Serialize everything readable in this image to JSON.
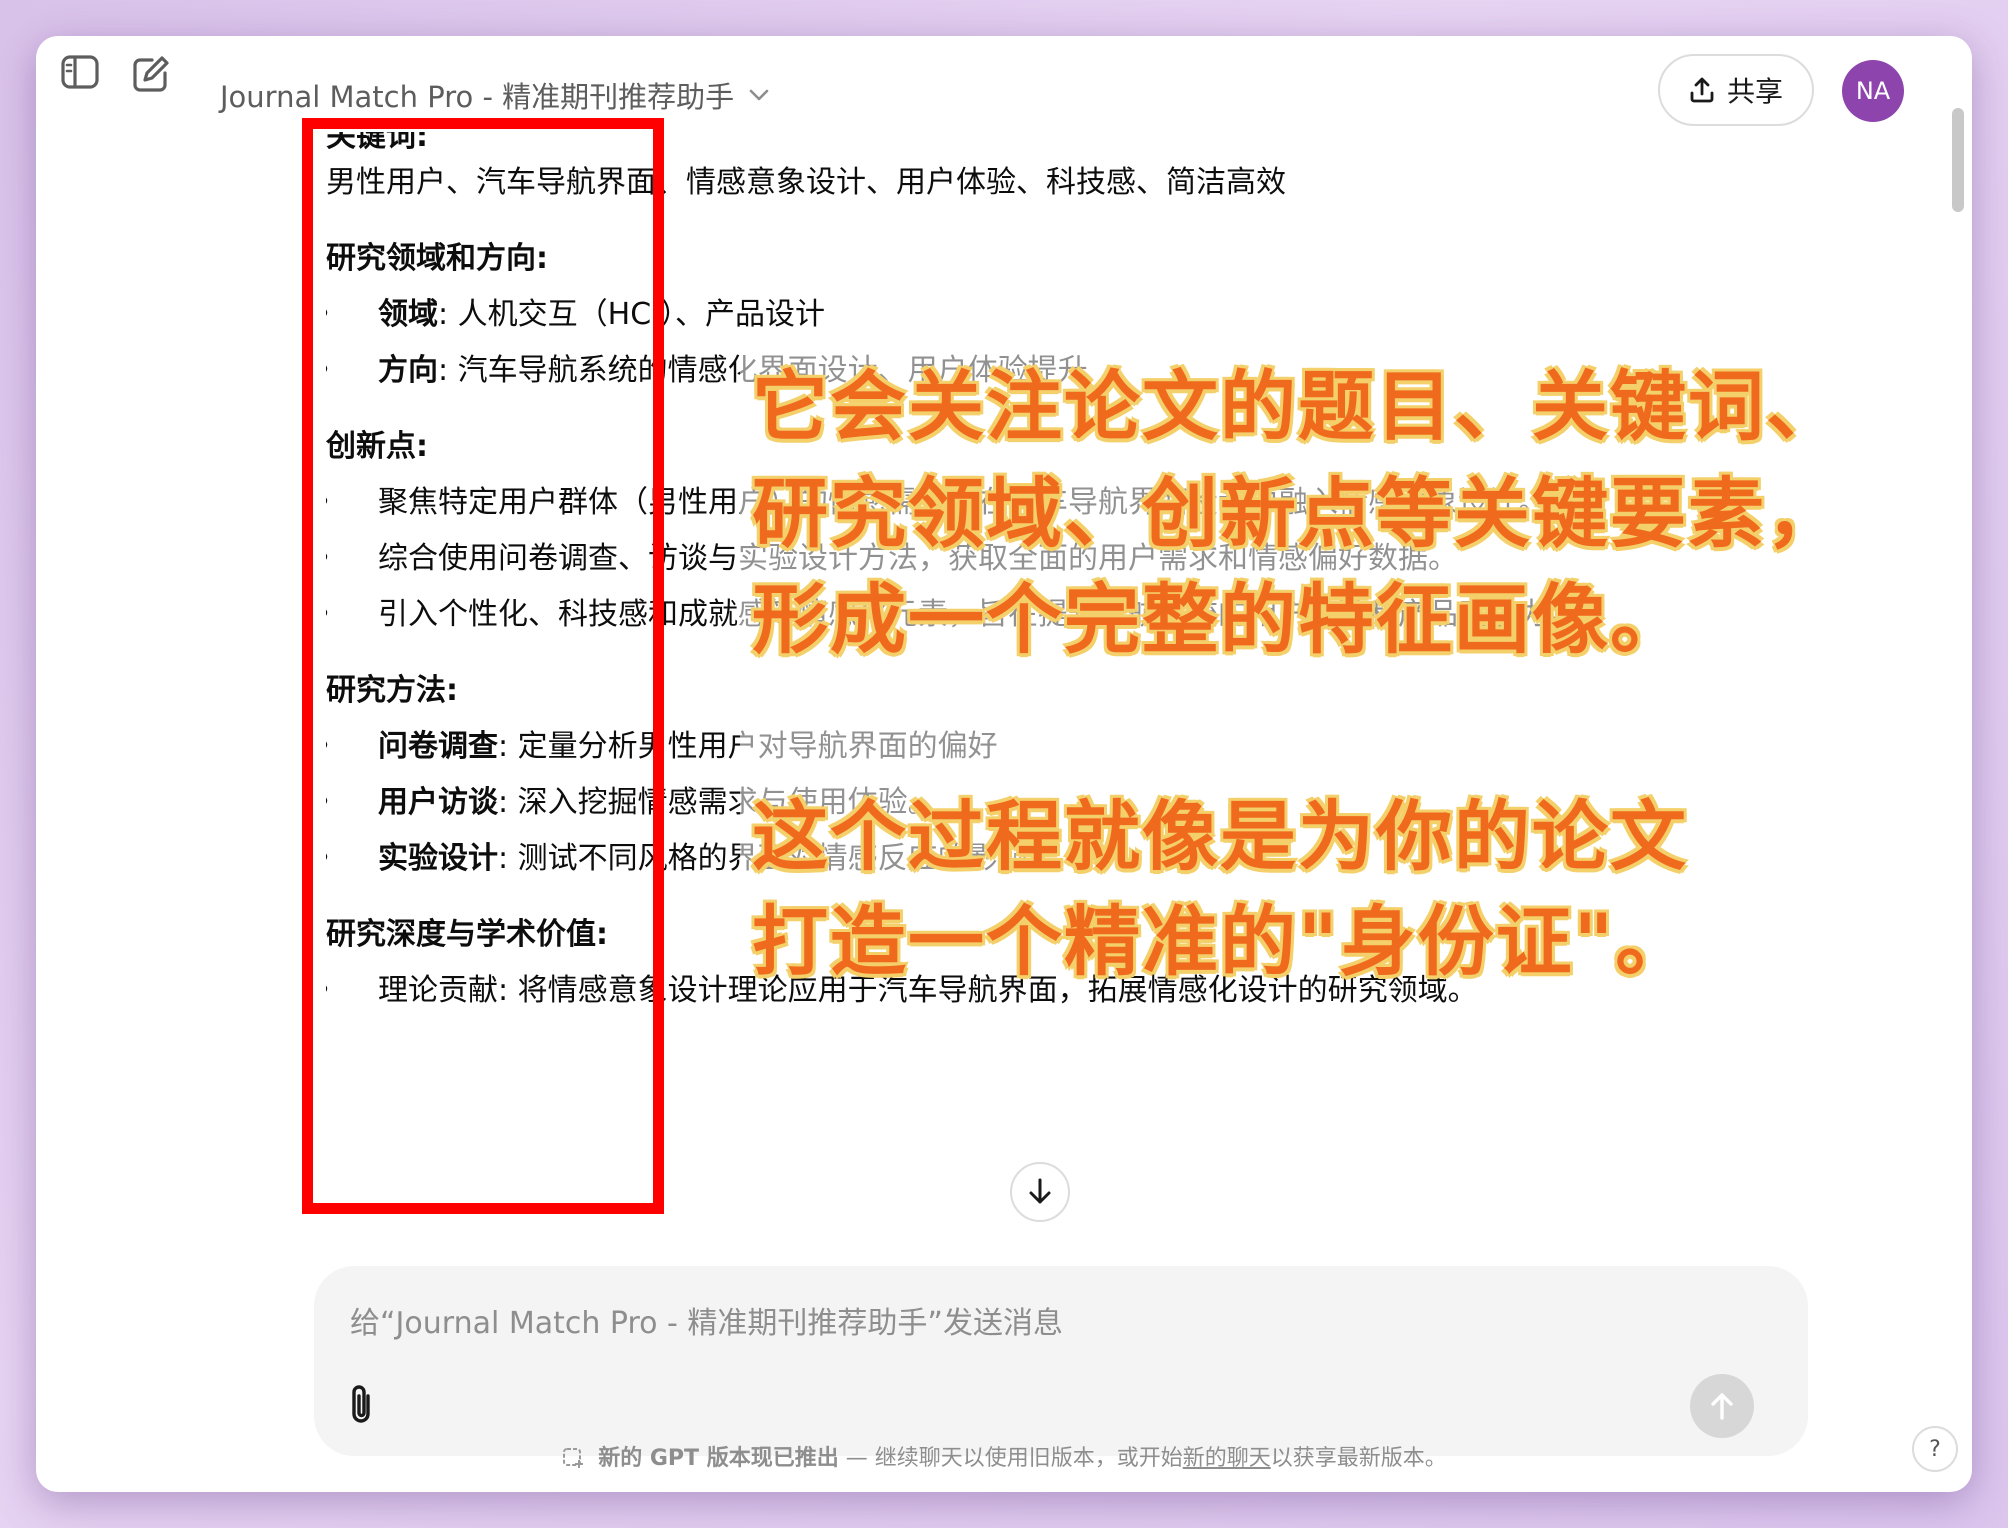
{
  "header": {
    "title": "Journal Match Pro - 精准期刊推荐助手",
    "share_label": "共享",
    "avatar_initials": "NA"
  },
  "content": {
    "keywords_heading": "关键词:",
    "keywords_text": "男性用户、汽车导航界面、情感意象设计、用户体验、科技感、简洁高效",
    "field_heading": "研究领域和方向:",
    "field_items": [
      {
        "label": "领域",
        "text": ": 人机交互（HCI）、产品设计"
      },
      {
        "label": "方向",
        "text": ": 汽车导航系统的情感化界面设计、用户体验提升"
      }
    ],
    "innovation_heading": "创新点:",
    "innovation_items": [
      "聚焦特定用户群体（男性用户）的情感需求，在汽车导航界面设计中融入情感意象设计。",
      "综合使用问卷调查、访谈与实验设计方法，获取全面的用户需求和情感偏好数据。",
      "引入个性化、科技感和成就感等情感化元素，旨在提升导航系统的用户体验和产品竞争力。"
    ],
    "method_heading": "研究方法:",
    "method_items": [
      {
        "label": "问卷调查",
        "text": ": 定量分析男性用户对导航界面的偏好"
      },
      {
        "label": "用户访谈",
        "text": ": 深入挖掘情感需求与使用体验。"
      },
      {
        "label": "实验设计",
        "text": ": 测试不同风格的界面对情感反应的影响。"
      }
    ],
    "depth_heading": "研究深度与学术价值:",
    "cut_line": "理论贡献: 将情感意象设计理论应用于汽车导航界面，拓展情感化设计的研究领域。"
  },
  "annotation": {
    "lines": [
      "它会关注论文的题目、关键词、",
      "研究领域、创新点等关键要素，",
      "形成一个完整的特征画像。",
      "这个过程就像是为你的论文",
      "打造一个精准的\"身份证\"。"
    ],
    "color": "#f06a1e",
    "outline_color": "#f4d06a"
  },
  "composer": {
    "placeholder": "给“Journal Match Pro - 精准期刊推荐助手”发送消息"
  },
  "footer": {
    "notice_prefix": "新的 GPT 版本现已推出",
    "notice_mid": " — 继续聊天以使用旧版本，或开始",
    "notice_link": "新的聊天",
    "notice_suffix": "以获享最新版本。",
    "help": "?"
  },
  "colors": {
    "accent_avatar": "#8e44ad",
    "highlight_box": "#ff0000",
    "background": "#e2cdf0"
  }
}
